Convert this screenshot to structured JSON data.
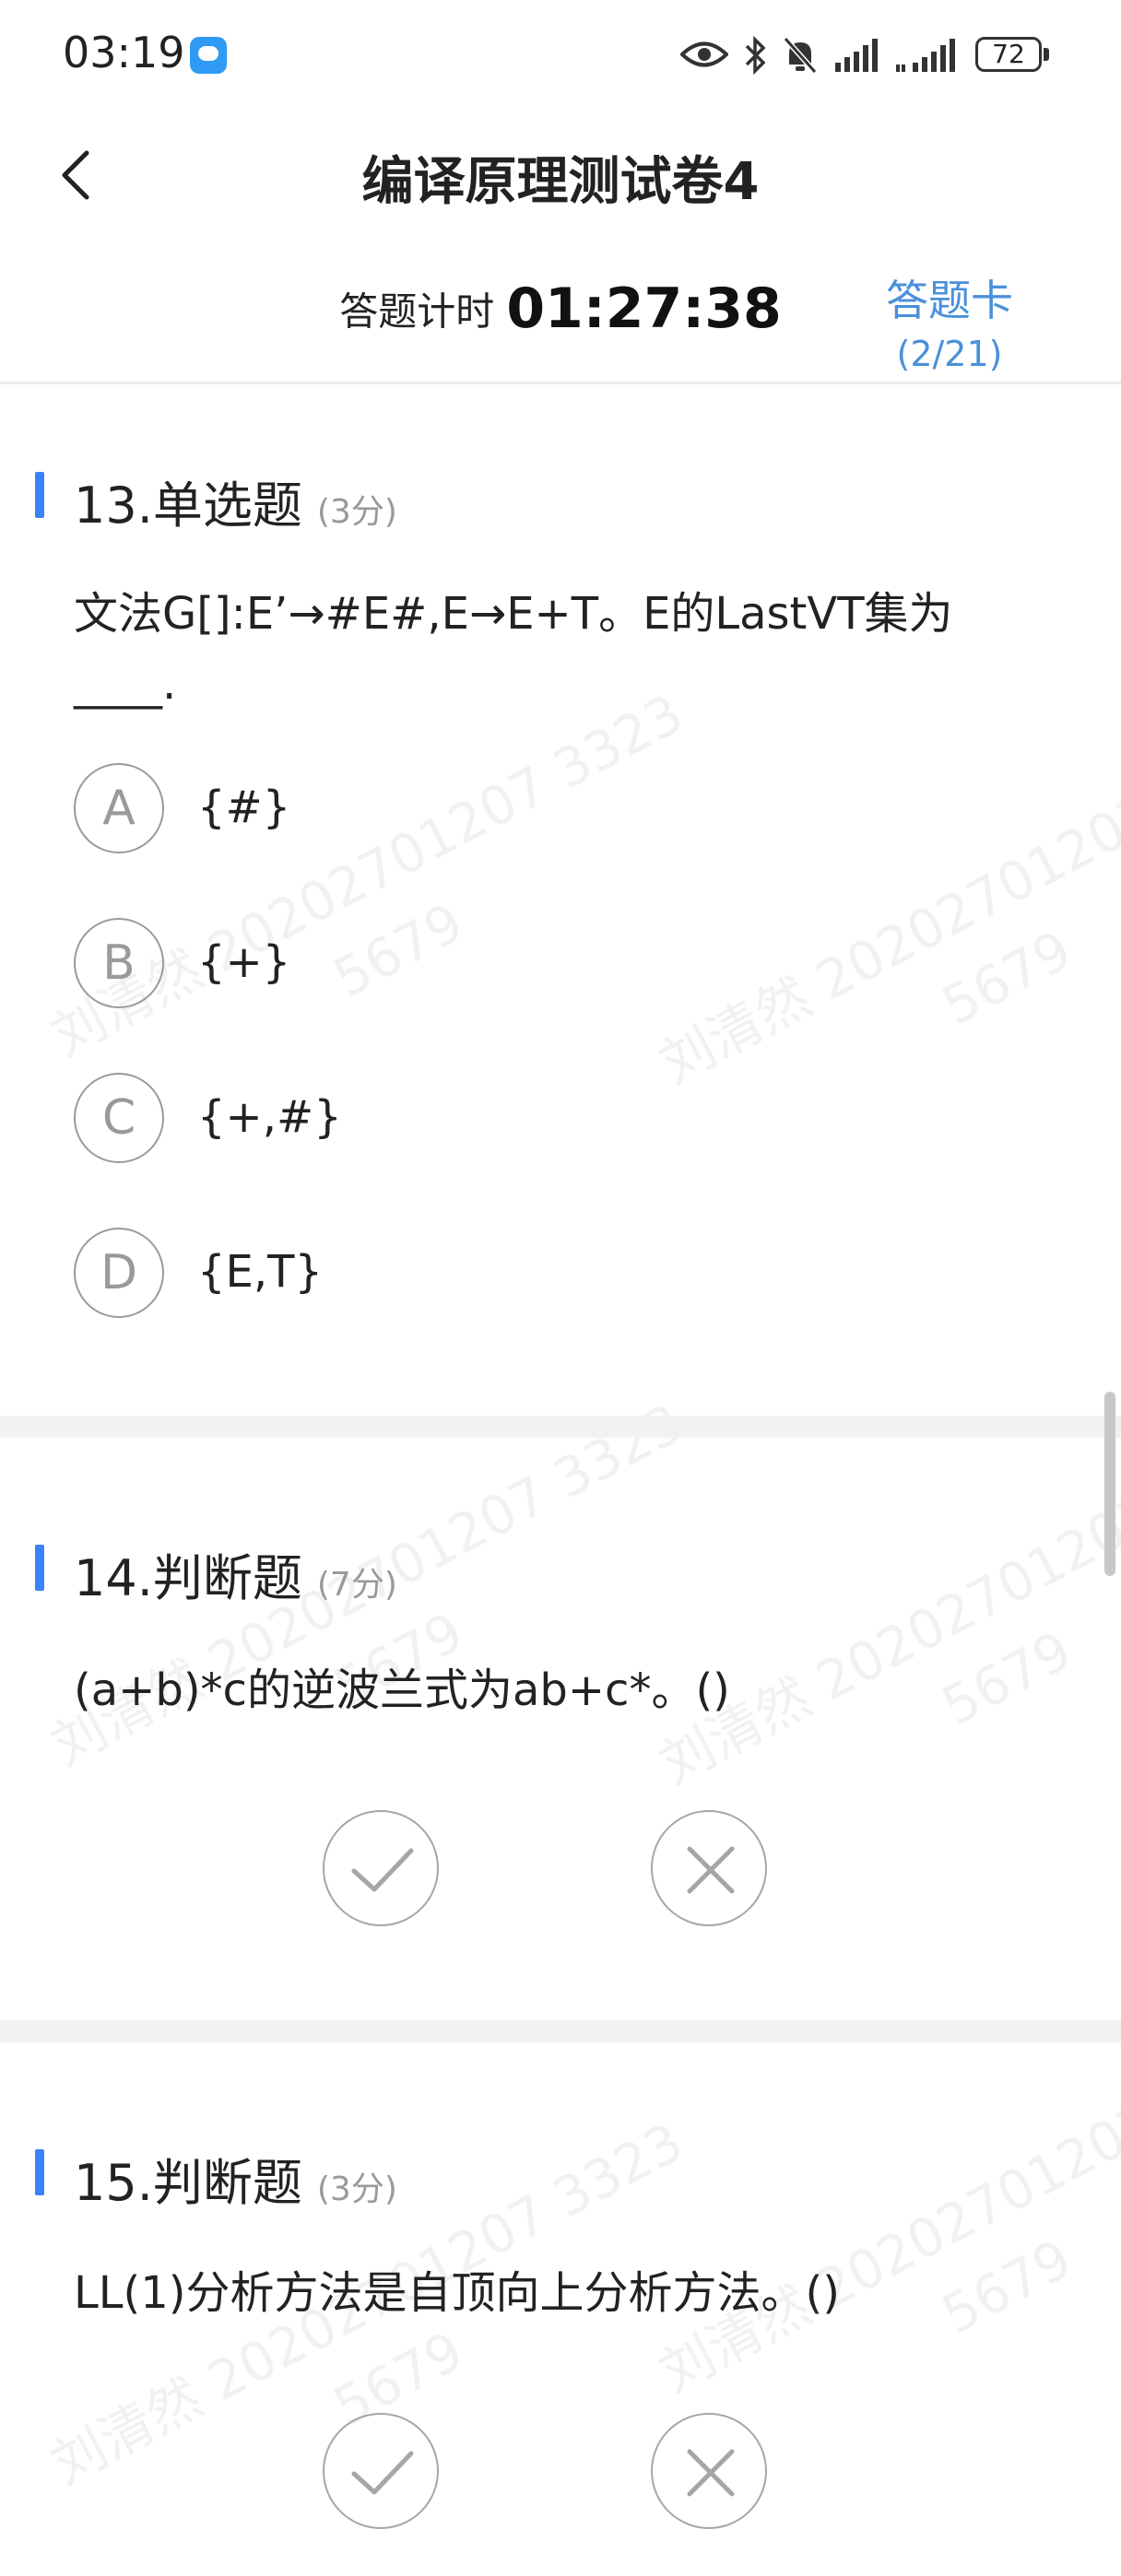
{
  "status_bar": {
    "time": "03:19",
    "battery": "72",
    "icons": [
      "chat-icon",
      "eye-icon",
      "bluetooth-icon",
      "mute-icon",
      "signal-icon",
      "signal-icon",
      "battery-icon"
    ]
  },
  "header": {
    "title": "编译原理测试卷4",
    "back_icon": "chevron-left-icon",
    "timer_label": "答题计时",
    "timer_value": "01:27:38",
    "answer_card_label": "答题卡",
    "answer_card_progress": "(2/21)"
  },
  "watermark": {
    "line1": "刘清然 20202701207 3323",
    "line2": "5679"
  },
  "questions": [
    {
      "title": "13.单选题",
      "score": "(3分)",
      "text": "文法G[]:E’→#E#,E→E+T。E的LastVT集为____.",
      "options": [
        {
          "letter": "A",
          "text": "{#}"
        },
        {
          "letter": "B",
          "text": "{+}"
        },
        {
          "letter": "C",
          "text": "{+,#}"
        },
        {
          "letter": "D",
          "text": "{E,T}"
        }
      ]
    },
    {
      "title": "14.判断题",
      "score": "(7分)",
      "text": "(a+b)*c的逆波兰式为ab+c*。()",
      "true_icon": "check-icon",
      "false_icon": "close-icon"
    },
    {
      "title": "15.判断题",
      "score": "(3分)",
      "text": "LL(1)分析方法是自顶向上分析方法。()",
      "true_icon": "check-icon",
      "false_icon": "close-icon"
    }
  ],
  "colors": {
    "accent": "#3b82f6",
    "link": "#4a90d9",
    "option_border": "#9a9a9a"
  }
}
